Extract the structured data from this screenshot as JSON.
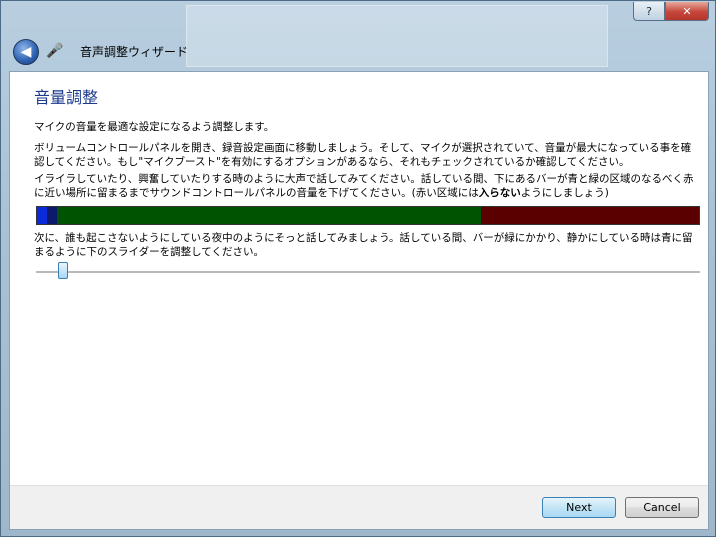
{
  "window": {
    "title": "音声調整ウィザード",
    "help_label": "?",
    "close_label": "✕"
  },
  "icons": {
    "back": "back-arrow-icon",
    "app": "microphone-app-icon"
  },
  "page": {
    "heading": "音量調整",
    "para1": "マイクの音量を最適な設定になるよう調整します。",
    "para2": "ボリュームコントロールパネルを開き、録音設定画面に移動しましょう。そして、マイクが選択されていて、音量が最大になっている事を確認してください。もし\"マイクブースト\"を有効にするオプションがあるなら、それもチェックされているか確認してください。",
    "para3_before": "イライラしていたり、興奮していたりする時のように大声で話してみてください。話している間、下にあるバーが青と緑の区域のなるべく赤に近い場所に留まるまでサウンドコントロールパネルの音量を下げてください。(赤い区域には",
    "para3_bold": "入らない",
    "para3_after": "ようにしましょう)",
    "para4": "次に、誰も起こさないようにしている夜中のようにそっと話してみましょう。話している間、バーが緑にかかり、静かにしている時は青に留まるように下のスライダーを調整してください。"
  },
  "meter": {
    "current_level": 0.015,
    "zones": [
      {
        "name": "blue",
        "fraction": 0.03,
        "color": "#0d1a6b"
      },
      {
        "name": "green",
        "fraction": 0.64,
        "color": "#005300"
      },
      {
        "name": "red",
        "fraction": 0.33,
        "color": "#5a0000"
      }
    ]
  },
  "slider": {
    "value": 0.04
  },
  "buttons": {
    "next": "Next",
    "cancel": "Cancel"
  },
  "colors": {
    "heading": "#1b3a8c",
    "accent": "#3c7fb1"
  }
}
